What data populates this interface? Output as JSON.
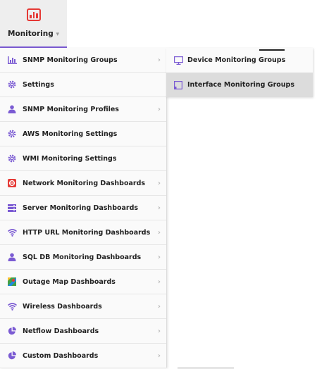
{
  "top_nav": {
    "label": "Monitoring",
    "caret": "▾",
    "icon": "bar-chart-icon"
  },
  "menu": {
    "items": [
      {
        "label": "SNMP Monitoring Groups",
        "icon": "bar-chart-icon",
        "has_arrow": true
      },
      {
        "label": "Settings",
        "icon": "gear-icon",
        "has_arrow": false
      },
      {
        "label": "SNMP Monitoring Profiles",
        "icon": "user-icon",
        "has_arrow": true
      },
      {
        "label": "AWS Monitoring Settings",
        "icon": "gear-icon",
        "has_arrow": false
      },
      {
        "label": "WMI Monitoring Settings",
        "icon": "gear-icon",
        "has_arrow": false
      },
      {
        "label": "Network Monitoring Dashboards",
        "icon": "globe-icon",
        "has_arrow": true
      },
      {
        "label": "Server Monitoring Dashboards",
        "icon": "server-icon",
        "has_arrow": true
      },
      {
        "label": "HTTP URL Monitoring Dashboards",
        "icon": "wifi-icon",
        "has_arrow": true
      },
      {
        "label": "SQL DB Monitoring Dashboards",
        "icon": "user-icon",
        "has_arrow": true
      },
      {
        "label": "Outage Map Dashboards",
        "icon": "map-icon",
        "has_arrow": true
      },
      {
        "label": "Wireless Dashboards",
        "icon": "wifi-icon",
        "has_arrow": true
      },
      {
        "label": "Netflow Dashboards",
        "icon": "pie-chart-icon",
        "has_arrow": true
      },
      {
        "label": "Custom Dashboards",
        "icon": "pie-chart-icon",
        "has_arrow": true
      }
    ],
    "arrow_glyph": "›"
  },
  "submenu": {
    "items": [
      {
        "label": "Device Monitoring Groups",
        "icon": "monitor-icon",
        "active": false
      },
      {
        "label": "Interface Monitoring Groups",
        "icon": "interface-icon",
        "active": true
      }
    ]
  },
  "colors": {
    "accent": "#7b5bd3",
    "brand_red": "#e53935",
    "menu_bg": "#fafafa",
    "active_bg": "#dcdcdc"
  }
}
